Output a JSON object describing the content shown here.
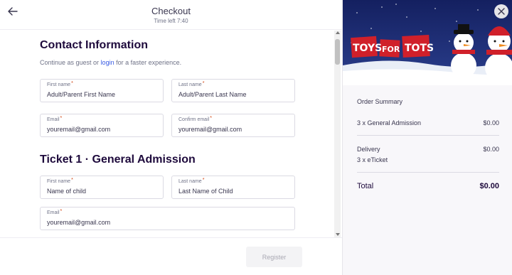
{
  "header": {
    "title": "Checkout",
    "time_left": "Time left 7:40"
  },
  "contact": {
    "title": "Contact Information",
    "subtitle_prefix": "Continue as guest or ",
    "login_link": "login",
    "subtitle_suffix": " for a faster experience.",
    "fields": {
      "first_name": {
        "label": "First name",
        "value": "Adult/Parent First Name"
      },
      "last_name": {
        "label": "Last name",
        "value": "Adult/Parent Last Name"
      },
      "email": {
        "label": "Email",
        "value": "youremail@gmail.com"
      },
      "confirm_email": {
        "label": "Confirm email",
        "value": "youremail@gmail.com"
      }
    }
  },
  "ticket": {
    "title": "Ticket 1 · General Admission",
    "fields": {
      "first_name": {
        "label": "First name",
        "value": "Name of child"
      },
      "last_name": {
        "label": "Last name",
        "value": "Last Name of Child"
      },
      "email": {
        "label": "Email",
        "value": "youremail@gmail.com"
      }
    }
  },
  "required_marker": "*",
  "footer": {
    "register_label": "Register"
  },
  "banner": {
    "logo_word_1": "TOYS",
    "logo_word_2": "FOR",
    "logo_word_3": "TOTS"
  },
  "order_summary": {
    "title": "Order Summary",
    "rows": [
      {
        "label": "3 x General Admission",
        "value": "$0.00"
      },
      {
        "label": "Delivery",
        "value": "$0.00",
        "sublabel": "3 x eTicket"
      }
    ],
    "total_label": "Total",
    "total_value": "$0.00"
  },
  "icons": {
    "back": "arrow-left-icon",
    "close": "close-icon"
  },
  "colors": {
    "link": "#3659e3",
    "required": "#d1410c",
    "banner_bg": "#1b2a6b",
    "logo_red": "#d0202a"
  }
}
